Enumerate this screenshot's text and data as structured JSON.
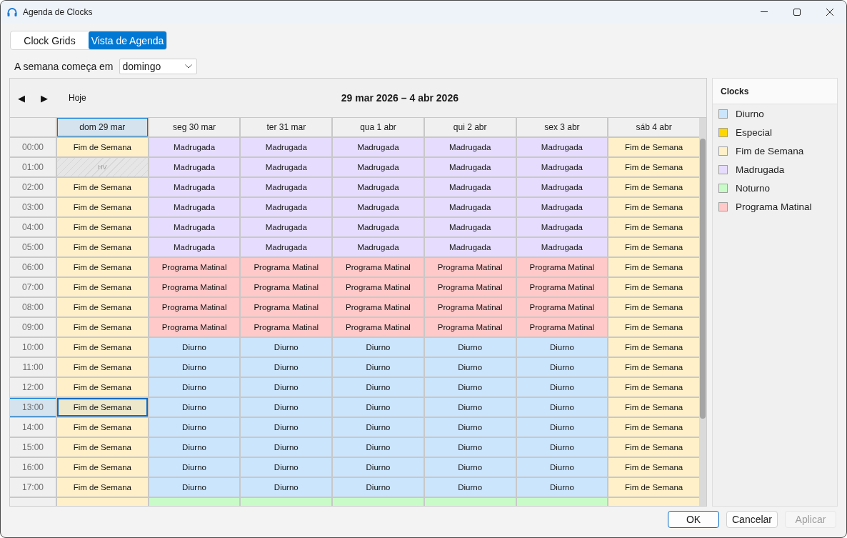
{
  "window": {
    "title": "Agenda de Clocks"
  },
  "tabs": [
    {
      "label": "Clock Grids",
      "selected": false
    },
    {
      "label": "Vista de Agenda",
      "selected": true
    }
  ],
  "week_start": {
    "label": "A semana começa em",
    "value": "domingo"
  },
  "calendar": {
    "nav": {
      "previous": "◀",
      "next": "▶",
      "today": "Hoje"
    },
    "range_title": "29 mar 2026 – 4 abr 2026",
    "days": [
      {
        "label": "dom 29 mar",
        "selected": true
      },
      {
        "label": "seg 30 mar",
        "selected": false
      },
      {
        "label": "ter 31 mar",
        "selected": false
      },
      {
        "label": "qua 1 abr",
        "selected": false
      },
      {
        "label": "qui 2 abr",
        "selected": false
      },
      {
        "label": "sex 3 abr",
        "selected": false
      },
      {
        "label": "sáb 4 abr",
        "selected": false
      }
    ],
    "rows": [
      {
        "time": "00:00",
        "selected": false,
        "cells": [
          {
            "kind": "clock",
            "text": "Fim de Semana",
            "color": "#fff0c9",
            "selected": false
          },
          {
            "kind": "clock",
            "text": "Madrugada",
            "color": "#e6ddfe",
            "selected": false
          },
          {
            "kind": "clock",
            "text": "Madrugada",
            "color": "#e6ddfe",
            "selected": false
          },
          {
            "kind": "clock",
            "text": "Madrugada",
            "color": "#e6ddfe",
            "selected": false
          },
          {
            "kind": "clock",
            "text": "Madrugada",
            "color": "#e6ddfe",
            "selected": false
          },
          {
            "kind": "clock",
            "text": "Madrugada",
            "color": "#e6ddfe",
            "selected": false
          },
          {
            "kind": "clock",
            "text": "Fim de Semana",
            "color": "#fff0c9",
            "selected": false
          }
        ]
      },
      {
        "time": "01:00",
        "selected": false,
        "cells": [
          {
            "kind": "unassigned",
            "text": "HV",
            "selected": false
          },
          {
            "kind": "clock",
            "text": "Madrugada",
            "color": "#e6ddfe",
            "selected": false
          },
          {
            "kind": "clock",
            "text": "Madrugada",
            "color": "#e6ddfe",
            "selected": false
          },
          {
            "kind": "clock",
            "text": "Madrugada",
            "color": "#e6ddfe",
            "selected": false
          },
          {
            "kind": "clock",
            "text": "Madrugada",
            "color": "#e6ddfe",
            "selected": false
          },
          {
            "kind": "clock",
            "text": "Madrugada",
            "color": "#e6ddfe",
            "selected": false
          },
          {
            "kind": "clock",
            "text": "Fim de Semana",
            "color": "#fff0c9",
            "selected": false
          }
        ]
      },
      {
        "time": "02:00",
        "selected": false,
        "cells": [
          {
            "kind": "clock",
            "text": "Fim de Semana",
            "color": "#fff0c9",
            "selected": false
          },
          {
            "kind": "clock",
            "text": "Madrugada",
            "color": "#e6ddfe",
            "selected": false
          },
          {
            "kind": "clock",
            "text": "Madrugada",
            "color": "#e6ddfe",
            "selected": false
          },
          {
            "kind": "clock",
            "text": "Madrugada",
            "color": "#e6ddfe",
            "selected": false
          },
          {
            "kind": "clock",
            "text": "Madrugada",
            "color": "#e6ddfe",
            "selected": false
          },
          {
            "kind": "clock",
            "text": "Madrugada",
            "color": "#e6ddfe",
            "selected": false
          },
          {
            "kind": "clock",
            "text": "Fim de Semana",
            "color": "#fff0c9",
            "selected": false
          }
        ]
      },
      {
        "time": "03:00",
        "selected": false,
        "cells": [
          {
            "kind": "clock",
            "text": "Fim de Semana",
            "color": "#fff0c9",
            "selected": false
          },
          {
            "kind": "clock",
            "text": "Madrugada",
            "color": "#e6ddfe",
            "selected": false
          },
          {
            "kind": "clock",
            "text": "Madrugada",
            "color": "#e6ddfe",
            "selected": false
          },
          {
            "kind": "clock",
            "text": "Madrugada",
            "color": "#e6ddfe",
            "selected": false
          },
          {
            "kind": "clock",
            "text": "Madrugada",
            "color": "#e6ddfe",
            "selected": false
          },
          {
            "kind": "clock",
            "text": "Madrugada",
            "color": "#e6ddfe",
            "selected": false
          },
          {
            "kind": "clock",
            "text": "Fim de Semana",
            "color": "#fff0c9",
            "selected": false
          }
        ]
      },
      {
        "time": "04:00",
        "selected": false,
        "cells": [
          {
            "kind": "clock",
            "text": "Fim de Semana",
            "color": "#fff0c9",
            "selected": false
          },
          {
            "kind": "clock",
            "text": "Madrugada",
            "color": "#e6ddfe",
            "selected": false
          },
          {
            "kind": "clock",
            "text": "Madrugada",
            "color": "#e6ddfe",
            "selected": false
          },
          {
            "kind": "clock",
            "text": "Madrugada",
            "color": "#e6ddfe",
            "selected": false
          },
          {
            "kind": "clock",
            "text": "Madrugada",
            "color": "#e6ddfe",
            "selected": false
          },
          {
            "kind": "clock",
            "text": "Madrugada",
            "color": "#e6ddfe",
            "selected": false
          },
          {
            "kind": "clock",
            "text": "Fim de Semana",
            "color": "#fff0c9",
            "selected": false
          }
        ]
      },
      {
        "time": "05:00",
        "selected": false,
        "cells": [
          {
            "kind": "clock",
            "text": "Fim de Semana",
            "color": "#fff0c9",
            "selected": false
          },
          {
            "kind": "clock",
            "text": "Madrugada",
            "color": "#e6ddfe",
            "selected": false
          },
          {
            "kind": "clock",
            "text": "Madrugada",
            "color": "#e6ddfe",
            "selected": false
          },
          {
            "kind": "clock",
            "text": "Madrugada",
            "color": "#e6ddfe",
            "selected": false
          },
          {
            "kind": "clock",
            "text": "Madrugada",
            "color": "#e6ddfe",
            "selected": false
          },
          {
            "kind": "clock",
            "text": "Madrugada",
            "color": "#e6ddfe",
            "selected": false
          },
          {
            "kind": "clock",
            "text": "Fim de Semana",
            "color": "#fff0c9",
            "selected": false
          }
        ]
      },
      {
        "time": "06:00",
        "selected": false,
        "cells": [
          {
            "kind": "clock",
            "text": "Fim de Semana",
            "color": "#fff0c9",
            "selected": false
          },
          {
            "kind": "clock",
            "text": "Programa Matinal",
            "color": "#ffc9c9",
            "selected": false
          },
          {
            "kind": "clock",
            "text": "Programa Matinal",
            "color": "#ffc9c9",
            "selected": false
          },
          {
            "kind": "clock",
            "text": "Programa Matinal",
            "color": "#ffc9c9",
            "selected": false
          },
          {
            "kind": "clock",
            "text": "Programa Matinal",
            "color": "#ffc9c9",
            "selected": false
          },
          {
            "kind": "clock",
            "text": "Programa Matinal",
            "color": "#ffc9c9",
            "selected": false
          },
          {
            "kind": "clock",
            "text": "Fim de Semana",
            "color": "#fff0c9",
            "selected": false
          }
        ]
      },
      {
        "time": "07:00",
        "selected": false,
        "cells": [
          {
            "kind": "clock",
            "text": "Fim de Semana",
            "color": "#fff0c9",
            "selected": false
          },
          {
            "kind": "clock",
            "text": "Programa Matinal",
            "color": "#ffc9c9",
            "selected": false
          },
          {
            "kind": "clock",
            "text": "Programa Matinal",
            "color": "#ffc9c9",
            "selected": false
          },
          {
            "kind": "clock",
            "text": "Programa Matinal",
            "color": "#ffc9c9",
            "selected": false
          },
          {
            "kind": "clock",
            "text": "Programa Matinal",
            "color": "#ffc9c9",
            "selected": false
          },
          {
            "kind": "clock",
            "text": "Programa Matinal",
            "color": "#ffc9c9",
            "selected": false
          },
          {
            "kind": "clock",
            "text": "Fim de Semana",
            "color": "#fff0c9",
            "selected": false
          }
        ]
      },
      {
        "time": "08:00",
        "selected": false,
        "cells": [
          {
            "kind": "clock",
            "text": "Fim de Semana",
            "color": "#fff0c9",
            "selected": false
          },
          {
            "kind": "clock",
            "text": "Programa Matinal",
            "color": "#ffc9c9",
            "selected": false
          },
          {
            "kind": "clock",
            "text": "Programa Matinal",
            "color": "#ffc9c9",
            "selected": false
          },
          {
            "kind": "clock",
            "text": "Programa Matinal",
            "color": "#ffc9c9",
            "selected": false
          },
          {
            "kind": "clock",
            "text": "Programa Matinal",
            "color": "#ffc9c9",
            "selected": false
          },
          {
            "kind": "clock",
            "text": "Programa Matinal",
            "color": "#ffc9c9",
            "selected": false
          },
          {
            "kind": "clock",
            "text": "Fim de Semana",
            "color": "#fff0c9",
            "selected": false
          }
        ]
      },
      {
        "time": "09:00",
        "selected": false,
        "cells": [
          {
            "kind": "clock",
            "text": "Fim de Semana",
            "color": "#fff0c9",
            "selected": false
          },
          {
            "kind": "clock",
            "text": "Programa Matinal",
            "color": "#ffc9c9",
            "selected": false
          },
          {
            "kind": "clock",
            "text": "Programa Matinal",
            "color": "#ffc9c9",
            "selected": false
          },
          {
            "kind": "clock",
            "text": "Programa Matinal",
            "color": "#ffc9c9",
            "selected": false
          },
          {
            "kind": "clock",
            "text": "Programa Matinal",
            "color": "#ffc9c9",
            "selected": false
          },
          {
            "kind": "clock",
            "text": "Programa Matinal",
            "color": "#ffc9c9",
            "selected": false
          },
          {
            "kind": "clock",
            "text": "Fim de Semana",
            "color": "#fff0c9",
            "selected": false
          }
        ]
      },
      {
        "time": "10:00",
        "selected": false,
        "cells": [
          {
            "kind": "clock",
            "text": "Fim de Semana",
            "color": "#fff0c9",
            "selected": false
          },
          {
            "kind": "clock",
            "text": "Diurno",
            "color": "#cbe5fd",
            "selected": false
          },
          {
            "kind": "clock",
            "text": "Diurno",
            "color": "#cbe5fd",
            "selected": false
          },
          {
            "kind": "clock",
            "text": "Diurno",
            "color": "#cbe5fd",
            "selected": false
          },
          {
            "kind": "clock",
            "text": "Diurno",
            "color": "#cbe5fd",
            "selected": false
          },
          {
            "kind": "clock",
            "text": "Diurno",
            "color": "#cbe5fd",
            "selected": false
          },
          {
            "kind": "clock",
            "text": "Fim de Semana",
            "color": "#fff0c9",
            "selected": false
          }
        ]
      },
      {
        "time": "11:00",
        "selected": false,
        "cells": [
          {
            "kind": "clock",
            "text": "Fim de Semana",
            "color": "#fff0c9",
            "selected": false
          },
          {
            "kind": "clock",
            "text": "Diurno",
            "color": "#cbe5fd",
            "selected": false
          },
          {
            "kind": "clock",
            "text": "Diurno",
            "color": "#cbe5fd",
            "selected": false
          },
          {
            "kind": "clock",
            "text": "Diurno",
            "color": "#cbe5fd",
            "selected": false
          },
          {
            "kind": "clock",
            "text": "Diurno",
            "color": "#cbe5fd",
            "selected": false
          },
          {
            "kind": "clock",
            "text": "Diurno",
            "color": "#cbe5fd",
            "selected": false
          },
          {
            "kind": "clock",
            "text": "Fim de Semana",
            "color": "#fff0c9",
            "selected": false
          }
        ]
      },
      {
        "time": "12:00",
        "selected": false,
        "cells": [
          {
            "kind": "clock",
            "text": "Fim de Semana",
            "color": "#fff0c9",
            "selected": false
          },
          {
            "kind": "clock",
            "text": "Diurno",
            "color": "#cbe5fd",
            "selected": false
          },
          {
            "kind": "clock",
            "text": "Diurno",
            "color": "#cbe5fd",
            "selected": false
          },
          {
            "kind": "clock",
            "text": "Diurno",
            "color": "#cbe5fd",
            "selected": false
          },
          {
            "kind": "clock",
            "text": "Diurno",
            "color": "#cbe5fd",
            "selected": false
          },
          {
            "kind": "clock",
            "text": "Diurno",
            "color": "#cbe5fd",
            "selected": false
          },
          {
            "kind": "clock",
            "text": "Fim de Semana",
            "color": "#fff0c9",
            "selected": false
          }
        ]
      },
      {
        "time": "13:00",
        "selected": true,
        "cells": [
          {
            "kind": "clock",
            "text": "Fim de Semana",
            "color": "#ede8cc",
            "selected": true
          },
          {
            "kind": "clock",
            "text": "Diurno",
            "color": "#cbe5fd",
            "selected": false
          },
          {
            "kind": "clock",
            "text": "Diurno",
            "color": "#cbe5fd",
            "selected": false
          },
          {
            "kind": "clock",
            "text": "Diurno",
            "color": "#cbe5fd",
            "selected": false
          },
          {
            "kind": "clock",
            "text": "Diurno",
            "color": "#cbe5fd",
            "selected": false
          },
          {
            "kind": "clock",
            "text": "Diurno",
            "color": "#cbe5fd",
            "selected": false
          },
          {
            "kind": "clock",
            "text": "Fim de Semana",
            "color": "#fff0c9",
            "selected": false
          }
        ]
      },
      {
        "time": "14:00",
        "selected": false,
        "cells": [
          {
            "kind": "clock",
            "text": "Fim de Semana",
            "color": "#fff0c9",
            "selected": false
          },
          {
            "kind": "clock",
            "text": "Diurno",
            "color": "#cbe5fd",
            "selected": false
          },
          {
            "kind": "clock",
            "text": "Diurno",
            "color": "#cbe5fd",
            "selected": false
          },
          {
            "kind": "clock",
            "text": "Diurno",
            "color": "#cbe5fd",
            "selected": false
          },
          {
            "kind": "clock",
            "text": "Diurno",
            "color": "#cbe5fd",
            "selected": false
          },
          {
            "kind": "clock",
            "text": "Diurno",
            "color": "#cbe5fd",
            "selected": false
          },
          {
            "kind": "clock",
            "text": "Fim de Semana",
            "color": "#fff0c9",
            "selected": false
          }
        ]
      },
      {
        "time": "15:00",
        "selected": false,
        "cells": [
          {
            "kind": "clock",
            "text": "Fim de Semana",
            "color": "#fff0c9",
            "selected": false
          },
          {
            "kind": "clock",
            "text": "Diurno",
            "color": "#cbe5fd",
            "selected": false
          },
          {
            "kind": "clock",
            "text": "Diurno",
            "color": "#cbe5fd",
            "selected": false
          },
          {
            "kind": "clock",
            "text": "Diurno",
            "color": "#cbe5fd",
            "selected": false
          },
          {
            "kind": "clock",
            "text": "Diurno",
            "color": "#cbe5fd",
            "selected": false
          },
          {
            "kind": "clock",
            "text": "Diurno",
            "color": "#cbe5fd",
            "selected": false
          },
          {
            "kind": "clock",
            "text": "Fim de Semana",
            "color": "#fff0c9",
            "selected": false
          }
        ]
      },
      {
        "time": "16:00",
        "selected": false,
        "cells": [
          {
            "kind": "clock",
            "text": "Fim de Semana",
            "color": "#fff0c9",
            "selected": false
          },
          {
            "kind": "clock",
            "text": "Diurno",
            "color": "#cbe5fd",
            "selected": false
          },
          {
            "kind": "clock",
            "text": "Diurno",
            "color": "#cbe5fd",
            "selected": false
          },
          {
            "kind": "clock",
            "text": "Diurno",
            "color": "#cbe5fd",
            "selected": false
          },
          {
            "kind": "clock",
            "text": "Diurno",
            "color": "#cbe5fd",
            "selected": false
          },
          {
            "kind": "clock",
            "text": "Diurno",
            "color": "#cbe5fd",
            "selected": false
          },
          {
            "kind": "clock",
            "text": "Fim de Semana",
            "color": "#fff0c9",
            "selected": false
          }
        ]
      },
      {
        "time": "17:00",
        "selected": false,
        "cells": [
          {
            "kind": "clock",
            "text": "Fim de Semana",
            "color": "#fff0c9",
            "selected": false
          },
          {
            "kind": "clock",
            "text": "Diurno",
            "color": "#cbe5fd",
            "selected": false
          },
          {
            "kind": "clock",
            "text": "Diurno",
            "color": "#cbe5fd",
            "selected": false
          },
          {
            "kind": "clock",
            "text": "Diurno",
            "color": "#cbe5fd",
            "selected": false
          },
          {
            "kind": "clock",
            "text": "Diurno",
            "color": "#cbe5fd",
            "selected": false
          },
          {
            "kind": "clock",
            "text": "Diurno",
            "color": "#cbe5fd",
            "selected": false
          },
          {
            "kind": "clock",
            "text": "Fim de Semana",
            "color": "#fff0c9",
            "selected": false
          }
        ]
      },
      {
        "selected": false,
        "cells": [
          {
            "kind": "clock",
            "color": "#fff0c9",
            "selected": false
          },
          {
            "kind": "clock",
            "color": "#c9fbc9",
            "selected": false
          },
          {
            "kind": "clock",
            "color": "#c9fbc9",
            "selected": false
          },
          {
            "kind": "clock",
            "color": "#c9fbc9",
            "selected": false
          },
          {
            "kind": "clock",
            "color": "#c9fbc9",
            "selected": false
          },
          {
            "kind": "clock",
            "color": "#c9fbc9",
            "selected": false
          },
          {
            "kind": "clock",
            "color": "#fff0c9",
            "selected": false
          }
        ]
      }
    ]
  },
  "legend": {
    "title": "Clocks",
    "items": [
      {
        "label": "Diurno",
        "color": "#cbe5fd"
      },
      {
        "label": "Especial",
        "color": "#ffd700"
      },
      {
        "label": "Fim de Semana",
        "color": "#fff0c9"
      },
      {
        "label": "Madrugada",
        "color": "#e6ddfe"
      },
      {
        "label": "Noturno",
        "color": "#c9fbc9"
      },
      {
        "label": "Programa Matinal",
        "color": "#ffc9c9"
      }
    ]
  },
  "buttons": [
    {
      "label": "OK",
      "kind": "default",
      "disabled": false
    },
    {
      "label": "Cancelar",
      "kind": "normal",
      "disabled": false
    },
    {
      "label": "Aplicar",
      "kind": "normal",
      "disabled": true
    }
  ]
}
